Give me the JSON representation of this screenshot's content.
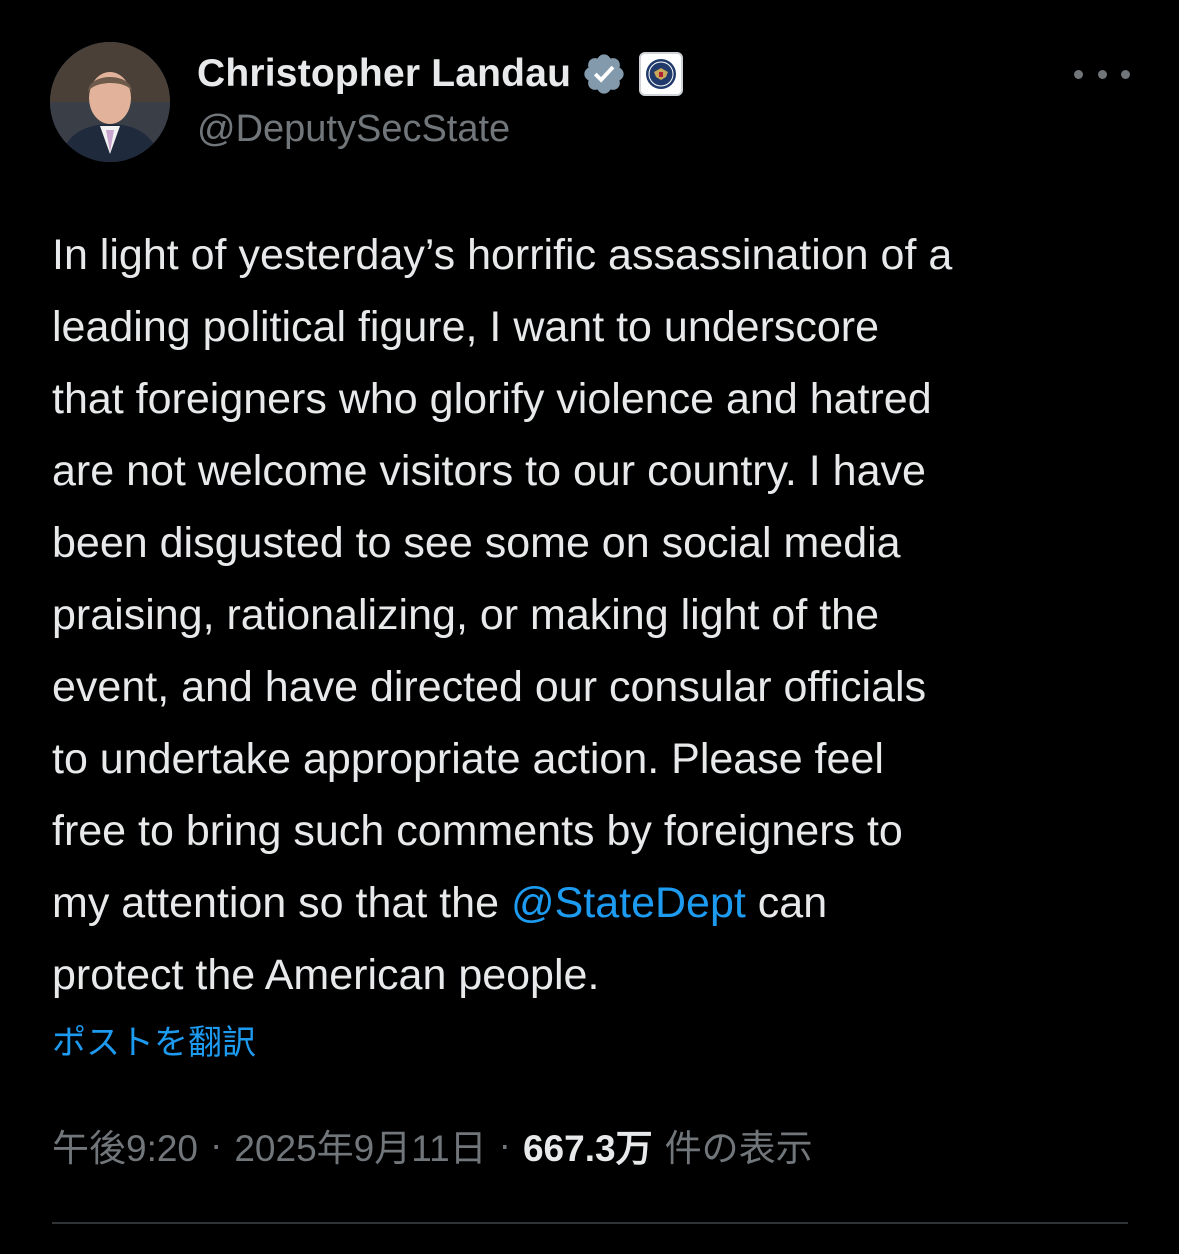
{
  "author": {
    "display_name": "Christopher Landau",
    "handle": "@DeputySecState",
    "verified_badge_color": "#829aab",
    "avatar_icon": "profile-photo",
    "affiliate_icon": "state-department-seal-icon"
  },
  "post": {
    "lines": [
      "In light of yesterday’s horrific assassination of a",
      "leading political figure, I want to underscore",
      "that foreigners who glorify violence and hatred",
      "are not welcome visitors to our country. I have",
      "been disgusted to see some on social media",
      "praising, rationalizing, or making light of the",
      "event, and have directed our consular officials",
      "to undertake appropriate action. Please feel",
      "free to bring such comments by foreigners to"
    ],
    "line_10_before": "my attention so that the ",
    "mention": "@StateDept",
    "line_10_after": " can",
    "line_11": "protect the American people."
  },
  "translate_label": "ポストを翻訳",
  "meta": {
    "time": "午後9:20",
    "separator": "·",
    "date": "2025年9月11日",
    "views_count": "667.3万",
    "views_label": "件の表示"
  },
  "colors": {
    "background": "#000000",
    "text": "#e7e9ea",
    "secondary": "#71767b",
    "link": "#1d9bf0"
  }
}
